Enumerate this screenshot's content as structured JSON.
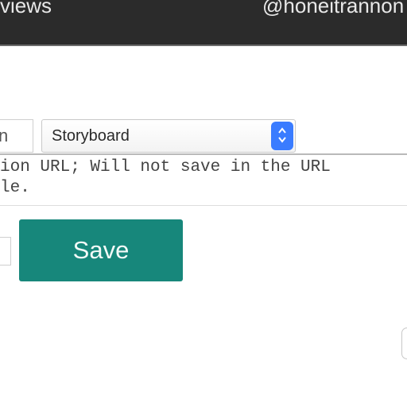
{
  "header": {
    "left_text": "views",
    "right_text": "@honeitrannon"
  },
  "form": {
    "left_field_text": "n",
    "select": {
      "selected": "Storyboard"
    },
    "note": {
      "line1": "ion URL; Will not save in the URL",
      "line2": "le."
    },
    "save_label": "Save"
  },
  "colors": {
    "topbar": "#2b2b2b",
    "save_button": "#17877b",
    "select_arrow": "#3a7cff"
  }
}
